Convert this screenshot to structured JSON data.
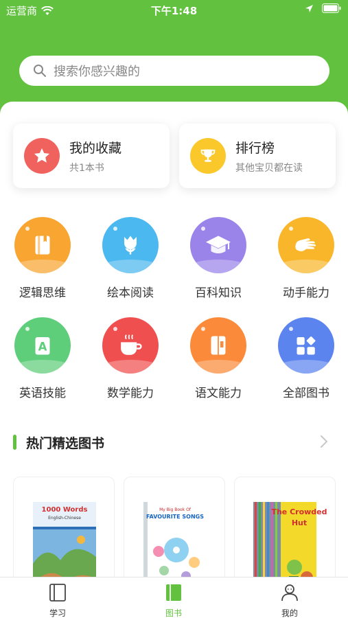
{
  "status_bar": {
    "carrier": "运营商",
    "time": "下午1:48"
  },
  "search": {
    "placeholder": "搜索你感兴趣的"
  },
  "quick_cards": {
    "favorites": {
      "title": "我的收藏",
      "subtitle": "共1本书",
      "color": "#f0625e"
    },
    "ranking": {
      "title": "排行榜",
      "subtitle": "其他宝贝都在读",
      "color": "#fbc82c"
    }
  },
  "categories": [
    {
      "label": "逻辑思维",
      "icon": "book-icon",
      "color": "#f8a531"
    },
    {
      "label": "绘本阅读",
      "icon": "tulip-icon",
      "color": "#4bb8ef"
    },
    {
      "label": "百科知识",
      "icon": "graduation-cap-icon",
      "color": "#9a84ea"
    },
    {
      "label": "动手能力",
      "icon": "hand-icon",
      "color": "#f9b62a"
    },
    {
      "label": "英语技能",
      "icon": "letter-a-icon",
      "color": "#5fce7a"
    },
    {
      "label": "数学能力",
      "icon": "coffee-cup-icon",
      "color": "#f04f50"
    },
    {
      "label": "语文能力",
      "icon": "notebook-icon",
      "color": "#fb8b3a"
    },
    {
      "label": "全部图书",
      "icon": "grid-icon",
      "color": "#5b84ef"
    }
  ],
  "hot_section": {
    "title": "热门精选图书"
  },
  "books": [
    {
      "title_line1": "1000 Words",
      "title_line2": "English-Chinese"
    },
    {
      "title_line1": "My Big Book Of",
      "title_line2": "FAVOURITE SONGS"
    },
    {
      "title_line1": "The Crowded",
      "title_line2": "Hut"
    }
  ],
  "tabbar": {
    "tabs": [
      {
        "label": "学习"
      },
      {
        "label": "图书"
      },
      {
        "label": "我的"
      }
    ],
    "active_color": "#62c23f"
  }
}
